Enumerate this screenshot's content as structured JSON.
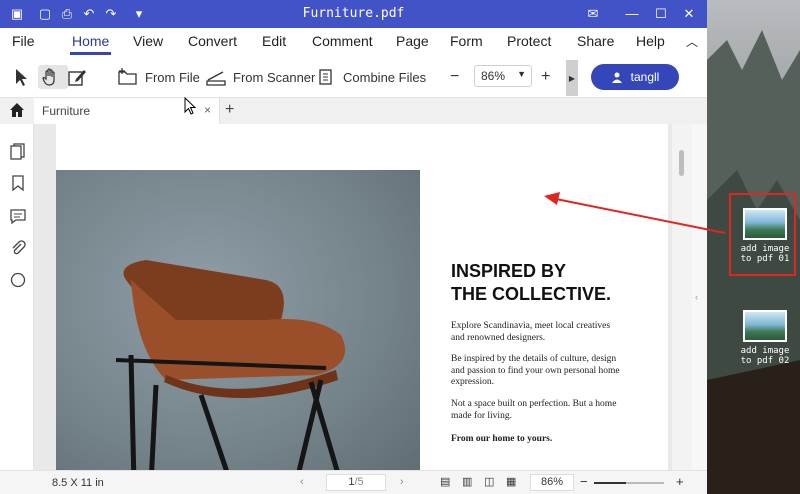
{
  "window": {
    "title": "Furniture.pdf"
  },
  "menu": [
    "File",
    "Home",
    "View",
    "Convert",
    "Edit",
    "Comment",
    "Page",
    "Form",
    "Protect",
    "Share",
    "Help"
  ],
  "toolbar": {
    "from_file": "From File",
    "from_scanner": "From Scanner",
    "combine_files": "Combine Files",
    "zoom_minus": "−",
    "zoom_value": "86%",
    "zoom_plus": "+",
    "user": "tangll"
  },
  "tabs": {
    "current": "Furniture",
    "close": "×",
    "new": "+"
  },
  "document": {
    "heading_line1": "INSPIRED BY",
    "heading_line2": "THE COLLECTIVE.",
    "para1": "Explore Scandinavia, meet local creatives and renowned designers.",
    "para2": "Be inspired by the details of culture, design and passion to find your own personal home expression.",
    "para3": "Not a space built on perfection. But a home made for living.",
    "para4": "From our home to yours."
  },
  "status": {
    "page_size": "8.5 X 11 in",
    "page_current": "1",
    "page_total": "/5",
    "zoom": "86%",
    "zoom_minus": "−",
    "zoom_plus": "+"
  },
  "desktop": {
    "icon1": "add image to pdf 01",
    "icon2": "add image to pdf 02"
  },
  "colors": {
    "accent": "#4153c6",
    "arrow": "#e0261f"
  }
}
